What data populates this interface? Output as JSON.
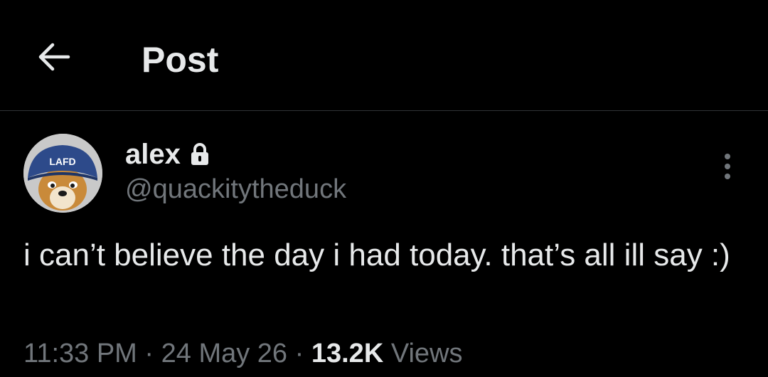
{
  "header": {
    "title": "Post",
    "back_icon": "arrow-left-icon"
  },
  "author": {
    "display_name": "alex",
    "handle": "@quackitytheduck",
    "protected_icon": "lock-icon",
    "avatar_hat_text": "LAFD",
    "more_icon": "more-vertical-icon"
  },
  "post": {
    "text": "i can’t believe the day i had today. that’s all ill say :)",
    "time": "11:33 PM",
    "separator": "·",
    "date": "24 May 26",
    "views_count": "13.2K",
    "views_label": "Views"
  },
  "colors": {
    "background": "#000000",
    "primary_text": "#e7e9ea",
    "secondary_text": "#71767b",
    "divider": "#2f3336"
  }
}
